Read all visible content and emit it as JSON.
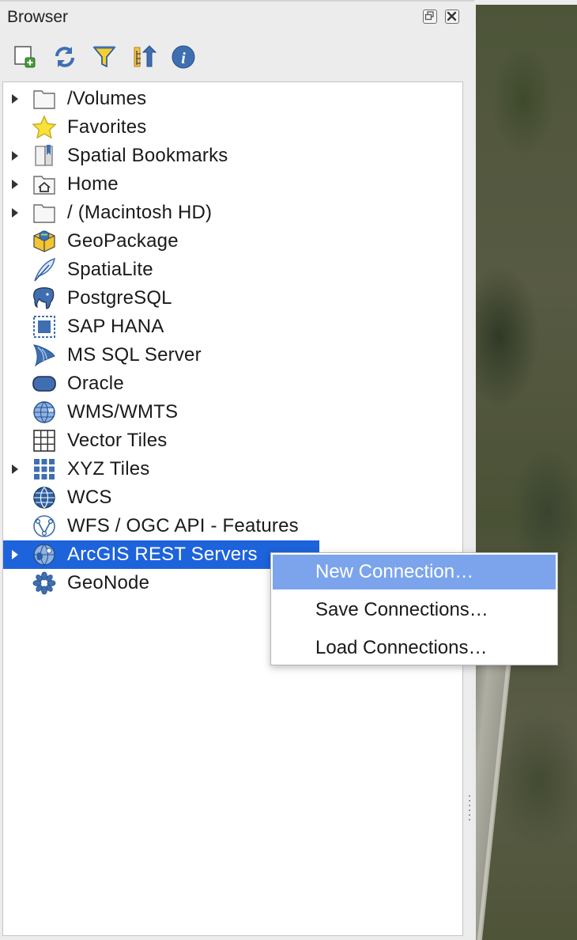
{
  "panel": {
    "title": "Browser",
    "toolbar": [
      {
        "name": "add-selected-layers-icon"
      },
      {
        "name": "refresh-icon"
      },
      {
        "name": "filter-icon"
      },
      {
        "name": "collapse-all-icon"
      },
      {
        "name": "info-icon"
      }
    ]
  },
  "tree": {
    "items": [
      {
        "label": "/Volumes",
        "icon": "folder-icon",
        "expandable": true,
        "selected": false
      },
      {
        "label": "Favorites",
        "icon": "star-icon",
        "expandable": false,
        "selected": false
      },
      {
        "label": "Spatial Bookmarks",
        "icon": "bookmark-icon",
        "expandable": true,
        "selected": false
      },
      {
        "label": "Home",
        "icon": "home-folder-icon",
        "expandable": true,
        "selected": false
      },
      {
        "label": "/ (Macintosh HD)",
        "icon": "folder-icon",
        "expandable": true,
        "selected": false
      },
      {
        "label": "GeoPackage",
        "icon": "geopackage-icon",
        "expandable": false,
        "selected": false
      },
      {
        "label": "SpatiaLite",
        "icon": "feather-icon",
        "expandable": false,
        "selected": false
      },
      {
        "label": "PostgreSQL",
        "icon": "elephant-icon",
        "expandable": false,
        "selected": false
      },
      {
        "label": "SAP HANA",
        "icon": "hana-icon",
        "expandable": false,
        "selected": false
      },
      {
        "label": "MS SQL Server",
        "icon": "mssql-icon",
        "expandable": false,
        "selected": false
      },
      {
        "label": "Oracle",
        "icon": "oracle-icon",
        "expandable": false,
        "selected": false
      },
      {
        "label": "WMS/WMTS",
        "icon": "wms-globe-icon",
        "expandable": false,
        "selected": false
      },
      {
        "label": "Vector Tiles",
        "icon": "vector-tiles-icon",
        "expandable": false,
        "selected": false
      },
      {
        "label": "XYZ Tiles",
        "icon": "xyz-tiles-icon",
        "expandable": true,
        "selected": false
      },
      {
        "label": "WCS",
        "icon": "wcs-globe-icon",
        "expandable": false,
        "selected": false
      },
      {
        "label": "WFS / OGC API - Features",
        "icon": "wfs-icon",
        "expandable": false,
        "selected": false
      },
      {
        "label": "ArcGIS REST Servers",
        "icon": "arcgis-globe-icon",
        "expandable": true,
        "selected": true
      },
      {
        "label": "GeoNode",
        "icon": "geonode-icon",
        "expandable": false,
        "selected": false
      }
    ]
  },
  "context_menu": {
    "items": [
      {
        "label": "New Connection…",
        "active": true
      },
      {
        "label": "Save Connections…",
        "active": false
      },
      {
        "label": "Load Connections…",
        "active": false
      }
    ]
  },
  "colors": {
    "selection": "#1d63db",
    "menu_highlight": "#7ba4ec",
    "icon_blue": "#3f6fb0"
  }
}
